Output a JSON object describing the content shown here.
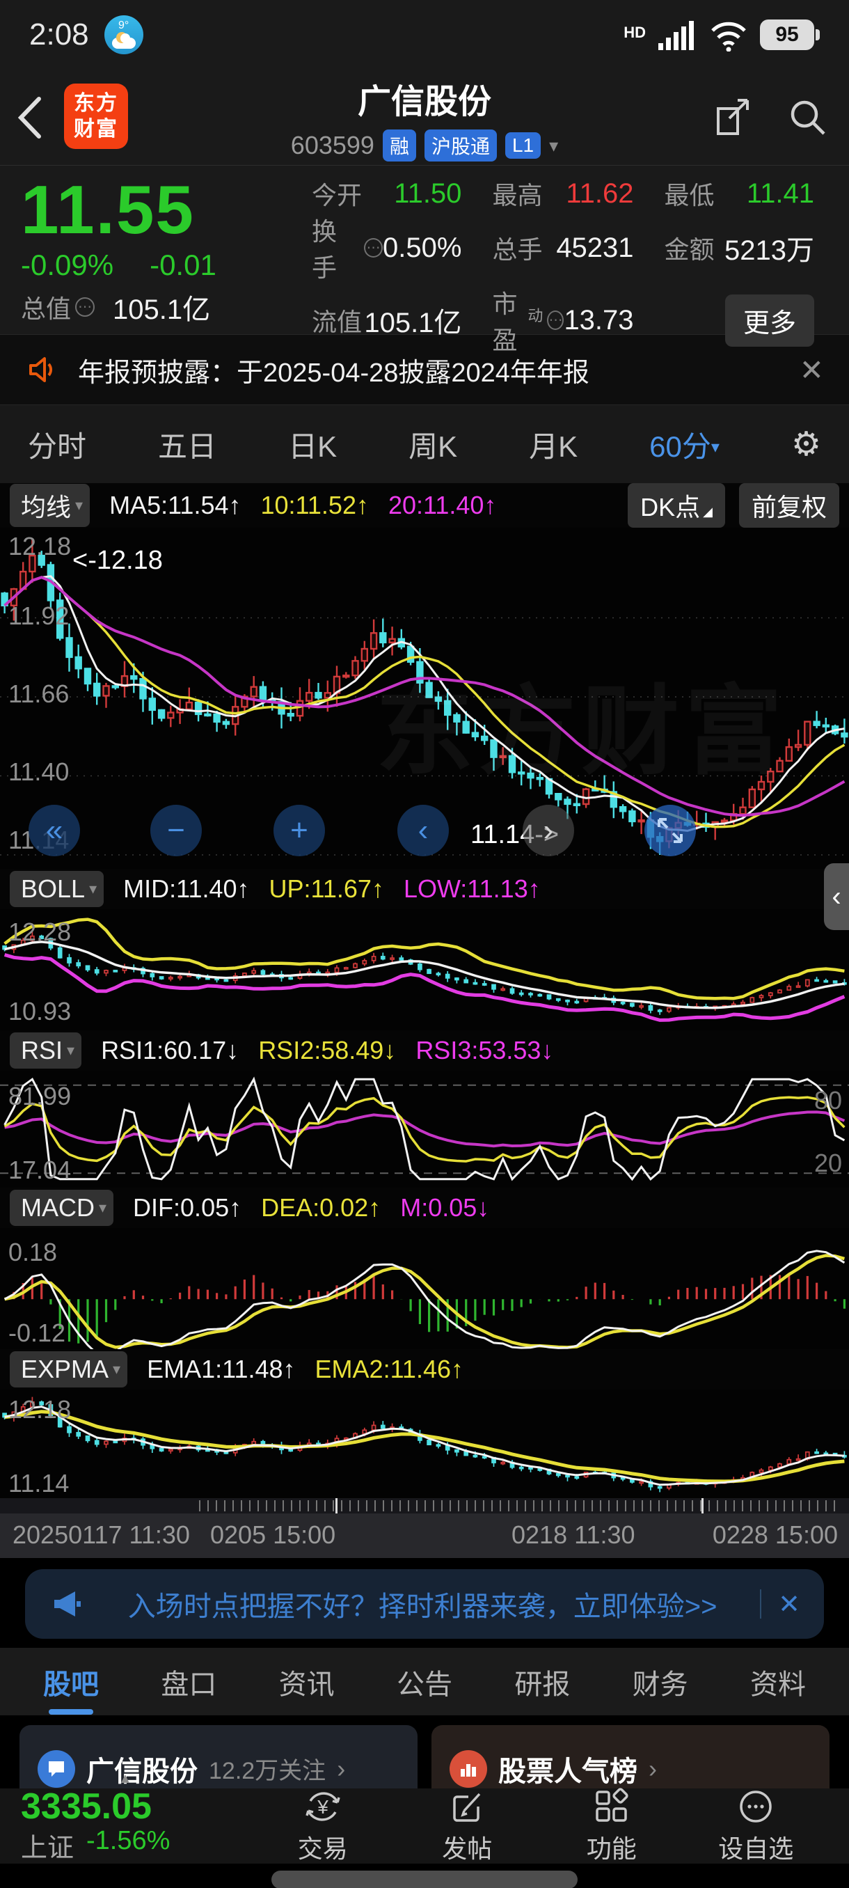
{
  "status": {
    "time": "2:08",
    "weather_temp": "9°",
    "hd": "HD",
    "battery": "95"
  },
  "header": {
    "logo_line1": "东方",
    "logo_line2": "财富",
    "title": "广信股份",
    "code": "603599",
    "badges": [
      "融",
      "沪股通",
      "L1"
    ]
  },
  "quote": {
    "price": "11.55",
    "change_pct": "-0.09%",
    "change": "-0.01",
    "open_label": "今开",
    "open": "11.50",
    "high_label": "最高",
    "high": "11.62",
    "low_label": "最低",
    "low": "11.41",
    "turnover_label": "换手",
    "turnover": "0.50%",
    "volume_label": "总手",
    "volume": "45231",
    "amount_label": "金额",
    "amount": "5213万",
    "mktcap_label": "总值",
    "mktcap": "105.1亿",
    "float_label": "流值",
    "floatcap": "105.1亿",
    "pe_label": "市盈",
    "pe_sup": "动",
    "pe": "13.73",
    "more_label": "更多"
  },
  "announcement": {
    "text": "年报预披露：于2025-04-28披露2024年年报",
    "close": "✕"
  },
  "period_tabs": {
    "items": [
      "分时",
      "五日",
      "日K",
      "周K",
      "月K"
    ],
    "active": "60分",
    "active_caret": "▾"
  },
  "ma_bar": {
    "selector": "均线",
    "caret": "▾",
    "ma5": "MA5:11.54↑",
    "ma10": "10:11.52↑",
    "ma20": "20:11.40↑",
    "dk": "DK点",
    "dk_corner": "◢",
    "fuquan": "前复权"
  },
  "main_chart": {
    "y_labels": [
      "12.18",
      "11.92",
      "11.66",
      "11.40",
      "11.14"
    ],
    "annotation_high": "<-12.18",
    "annotation_low": "11.14->",
    "watermark": "东方财富"
  },
  "boll_bar": {
    "selector": "BOLL",
    "mid": "MID:11.40↑",
    "up": "UP:11.67↑",
    "low": "LOW:11.13↑",
    "labels": [
      "12.28",
      "10.93"
    ],
    "handle": "‹"
  },
  "rsi_bar": {
    "selector": "RSI",
    "rsi1": "RSI1:60.17↓",
    "rsi2": "RSI2:58.49↓",
    "rsi3": "RSI3:53.53↓",
    "labels": [
      "81.99",
      "17.04"
    ],
    "right_labels": [
      "80",
      "20"
    ]
  },
  "macd_bar": {
    "selector": "MACD",
    "dif": "DIF:0.05↑",
    "dea": "DEA:0.02↑",
    "m": "M:0.05↓",
    "labels": [
      "0.18",
      "-0.12"
    ]
  },
  "expma_bar": {
    "selector": "EXPMA",
    "ema1": "EMA1:11.48↑",
    "ema2": "EMA2:11.46↑",
    "labels": [
      "12.18",
      "11.14"
    ]
  },
  "x_axis": {
    "ticks": [
      "20250117 11:30",
      "0205 15:00",
      "0218 11:30",
      "0228 15:00"
    ]
  },
  "ad": {
    "text": "入场时点把握不好？择时利器来袭，立即体验>>",
    "close": "✕"
  },
  "bottom_tabs": {
    "active": "股吧",
    "items": [
      "盘口",
      "资讯",
      "公告",
      "研报",
      "财务",
      "资料"
    ]
  },
  "cards": {
    "left_title": "广信股份",
    "left_sub": "12.2万关注",
    "right_title": "股票人气榜",
    "chevron": "›"
  },
  "bottom_nav": {
    "index_value": "3335.05",
    "index_name": "上证",
    "index_pct": "-1.56%",
    "expand_tri": "▲",
    "items": [
      "交易",
      "发帖",
      "功能",
      "设自选"
    ]
  },
  "icons": {
    "rewind": "«",
    "minus": "−",
    "plus": "+",
    "prev": "‹",
    "next": "›",
    "gear": "⚙"
  },
  "colors": {
    "up_red": "#d03a3a",
    "down_cyan": "#4ddfe4",
    "yellow": "#e6df38",
    "magenta": "#c636c6",
    "green_text": "#2bcb2b",
    "blue": "#4a93e8"
  },
  "charts": {
    "count": 92,
    "hi": 12.18,
    "lo": 11.14,
    "main_range": [
      11.14,
      12.18
    ],
    "rsi_range": [
      14,
      86
    ],
    "rsi_guides": [
      80,
      20
    ],
    "macd_range": [
      -0.12,
      0.18
    ],
    "trend": [
      11.96,
      12.14,
      11.8,
      11.66,
      11.73,
      11.6,
      11.64,
      11.56,
      11.68,
      11.61,
      11.66,
      11.74,
      11.87,
      11.79,
      11.62,
      11.54,
      11.46,
      11.38,
      11.31,
      11.36,
      11.27,
      11.2,
      11.26,
      11.22,
      11.33,
      11.47,
      11.58,
      11.55
    ]
  }
}
